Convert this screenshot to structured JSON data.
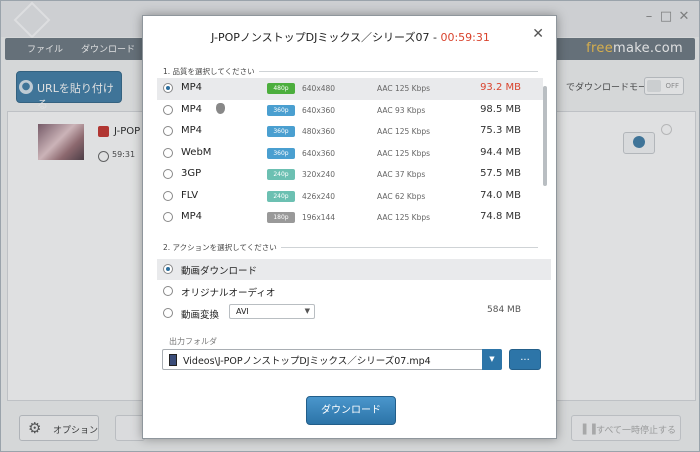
{
  "app": {
    "menu": [
      "ファイル",
      "ダウンロード"
    ],
    "brand_accent": "free",
    "brand_rest": "make.com",
    "url_button": "URLを貼り付ける",
    "mode_label": "でダウンロードモード",
    "toggle_label": "OFF",
    "item": {
      "title": "J-POP",
      "duration": "59:31"
    },
    "options_button": "オプション",
    "pause_all_button": "すべて一時停止する",
    "colors": {
      "accent": "#2d75a8",
      "time": "#d9432d",
      "menubar": "#6b7780",
      "brand": "#f5c34b"
    }
  },
  "dialog": {
    "title": "J-POPノンストップDJミックス／シリーズ07",
    "title_sep": " - ",
    "duration": "00:59:31",
    "section1": "1. 品質を選択してください",
    "qualities": [
      {
        "format": "MP4",
        "badge": "480p",
        "badge_color": "#4cae3d",
        "resolution": "640x480",
        "audio": "AAC 125  Kbps",
        "size": "93.2 MB",
        "selected": true
      },
      {
        "format": "MP4",
        "badge": "360p",
        "badge_color": "#4a9fd0",
        "resolution": "640x360",
        "audio": "AAC 93  Kbps",
        "size": "98.5 MB",
        "selected": false,
        "icon": "apple-icon"
      },
      {
        "format": "MP4",
        "badge": "360p",
        "badge_color": "#4a9fd0",
        "resolution": "480x360",
        "audio": "AAC 125  Kbps",
        "size": "75.3 MB",
        "selected": false
      },
      {
        "format": "WebM",
        "badge": "360p",
        "badge_color": "#4a9fd0",
        "resolution": "640x360",
        "audio": "AAC 125  Kbps",
        "size": "94.4 MB",
        "selected": false
      },
      {
        "format": "3GP",
        "badge": "240p",
        "badge_color": "#6cc0b2",
        "resolution": "320x240",
        "audio": "AAC 37  Kbps",
        "size": "57.5 MB",
        "selected": false
      },
      {
        "format": "FLV",
        "badge": "240p",
        "badge_color": "#6cc0b2",
        "resolution": "426x240",
        "audio": "AAC 62  Kbps",
        "size": "74.0 MB",
        "selected": false
      },
      {
        "format": "MP4",
        "badge": "180p",
        "badge_color": "#999999",
        "resolution": "196x144",
        "audio": "AAC 125  Kbps",
        "size": "74.8 MB",
        "selected": false
      }
    ],
    "section2": "2. アクションを選択してください",
    "actions": [
      {
        "label": "動画ダウンロード",
        "selected": true
      },
      {
        "label": "オリジナルオーディオ",
        "selected": false
      },
      {
        "label": "動画変換",
        "selected": false
      }
    ],
    "convert_format": "AVI",
    "convert_size": "584 MB",
    "folder_label": "出力フォルダ",
    "folder_path": "Videos\\J-POPノンストップDJミックス／シリーズ07.mp4",
    "browse_label": "...",
    "download_button": "ダウンロード"
  }
}
